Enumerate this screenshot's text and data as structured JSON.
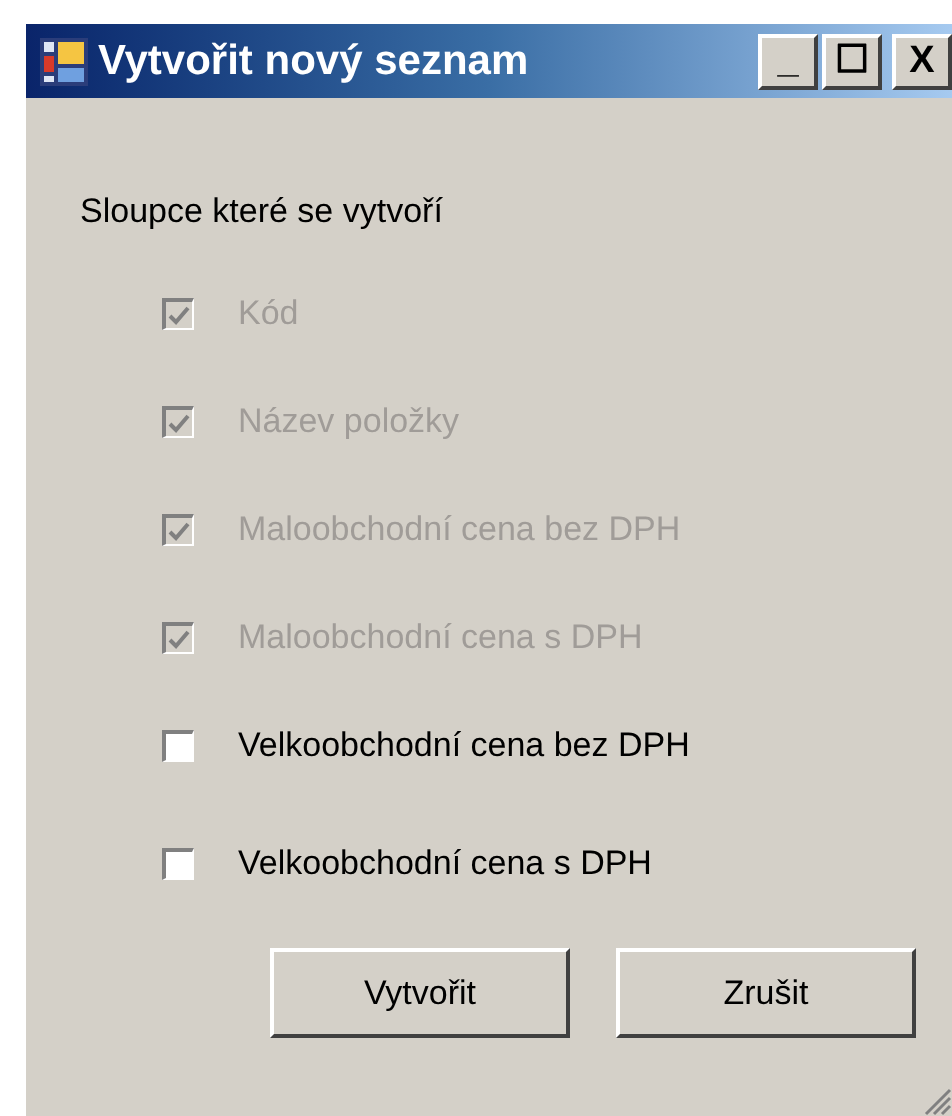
{
  "window": {
    "title": "Vytvořit nový seznam",
    "controls": [
      "_",
      "☐",
      "X"
    ]
  },
  "label": "Sloupce které se vytvoří",
  "columns": [
    {
      "label": "Kód",
      "checked": true,
      "disabled": true
    },
    {
      "label": "Název položky",
      "checked": true,
      "disabled": true
    },
    {
      "label": "Maloobchodní cena bez DPH",
      "checked": true,
      "disabled": true
    },
    {
      "label": "Maloobchodní cena s DPH",
      "checked": true,
      "disabled": true
    },
    {
      "label": "Velkoobchodní cena bez DPH",
      "checked": false,
      "disabled": false
    },
    {
      "label": "Velkoobchodní cena s DPH",
      "checked": false,
      "disabled": false
    }
  ],
  "buttons": [
    "Vytvořit",
    "Zrušit"
  ]
}
